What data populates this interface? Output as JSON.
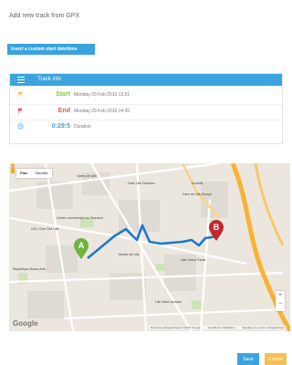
{
  "page": {
    "title": "Add new track from GPX"
  },
  "custom_date_button": "Insert a custom start date/time",
  "track_info": {
    "title": "Track info",
    "start": {
      "label": "Start",
      "value": "Monday 29 Feb 2016 13:51"
    },
    "end": {
      "label": "End",
      "value": "Monday 29 Feb 2016 14:20"
    },
    "duration": {
      "label": "0:29:5",
      "value": "Duration"
    }
  },
  "map": {
    "type_options": [
      "Plan",
      "Satellite"
    ],
    "markers": [
      "A",
      "B"
    ],
    "labels": [
      "Opéra de Lille",
      "Gare Lille Flandres",
      "Euralille",
      "Gare de Lille Europe",
      "Lille Saint-Sauveur",
      "Musée de Lille",
      "République Beaux Arts",
      "Lille Grand Palais",
      "Centre commercial Les Tanneurs",
      "UGC Ciné Cité Lille"
    ],
    "attribution": [
      "Données cartographiques ©2016 Google",
      "Conditions d'utilisation",
      "Signaler une erreur cartographique"
    ],
    "google": "Google",
    "zoom_in": "+",
    "zoom_out": "−",
    "colors": {
      "route": "#1f78c8",
      "marker_a": "#6db33f",
      "marker_b": "#c1272d"
    }
  },
  "actions": {
    "save": "Save",
    "cancel": "Cancel"
  }
}
